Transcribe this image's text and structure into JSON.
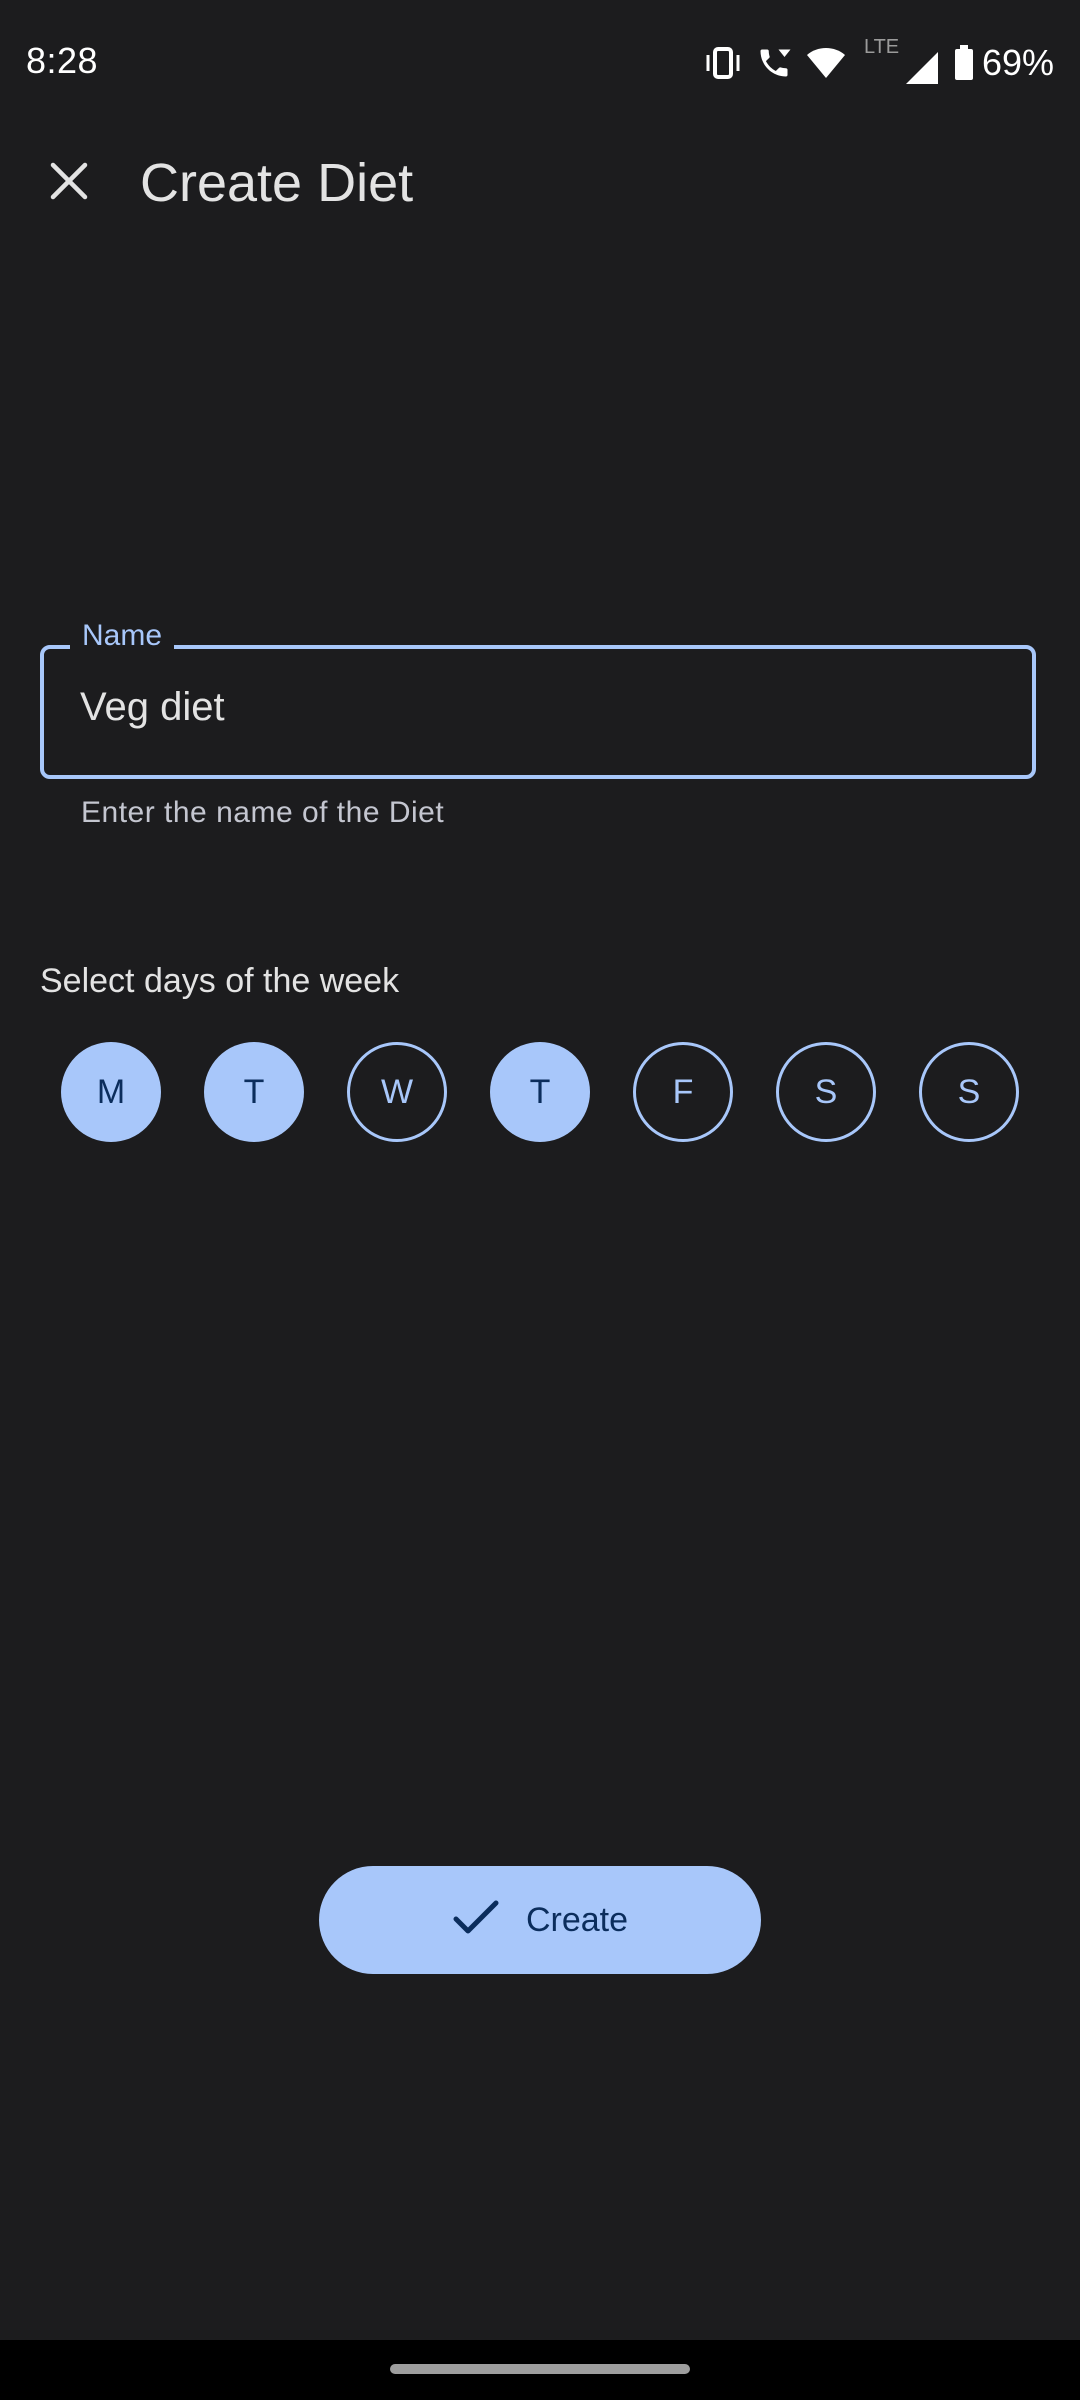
{
  "status_bar": {
    "time": "8:28",
    "network_type": "LTE",
    "battery_percent": "69%",
    "icons": [
      "vibrate-icon",
      "wifi-calling-icon",
      "wifi-icon",
      "cellular-signal-icon",
      "battery-icon"
    ]
  },
  "app_bar": {
    "close_icon": "close-icon",
    "title": "Create Diet"
  },
  "name_field": {
    "label": "Name",
    "value": "Veg diet",
    "helper_text": "Enter the name of the Diet"
  },
  "days_section": {
    "heading": "Select days of the week",
    "days": [
      {
        "label": "M",
        "selected": true
      },
      {
        "label": "T",
        "selected": true
      },
      {
        "label": "W",
        "selected": false
      },
      {
        "label": "T",
        "selected": true
      },
      {
        "label": "F",
        "selected": false
      },
      {
        "label": "S",
        "selected": false
      },
      {
        "label": "S",
        "selected": false
      }
    ]
  },
  "create_button": {
    "label": "Create",
    "icon": "check-icon"
  },
  "colors": {
    "background": "#1c1c1e",
    "accent": "#a8c7fa",
    "on_accent": "#0b2d5c",
    "text_primary": "#e3e3e3",
    "text_secondary": "#c4c6d0"
  }
}
